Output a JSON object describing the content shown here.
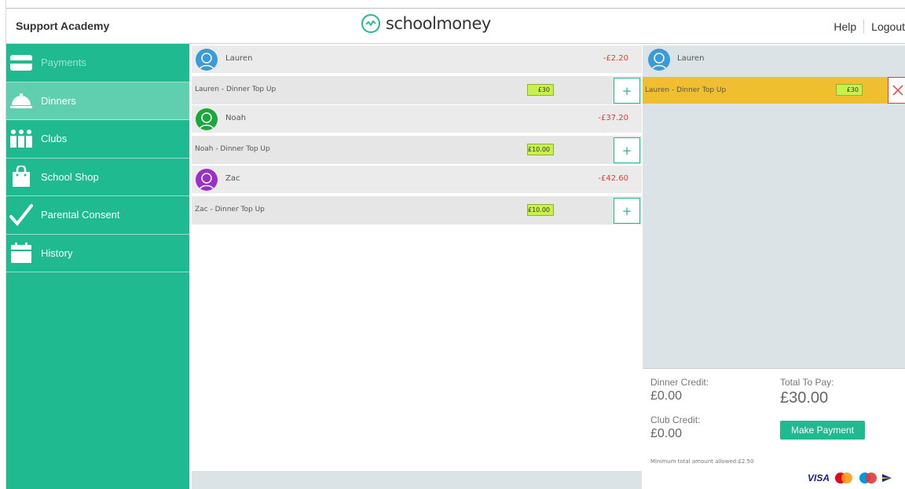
{
  "header": {
    "school_name": "Support Academy",
    "brand": "schoolmoney",
    "help": "Help",
    "logout": "Logout"
  },
  "sidebar": {
    "items": [
      {
        "label": "Payments",
        "icon": "card-icon"
      },
      {
        "label": "Dinners",
        "icon": "cloche-icon",
        "active": true
      },
      {
        "label": "Clubs",
        "icon": "people-icon"
      },
      {
        "label": "School Shop",
        "icon": "shopping-bag-icon"
      },
      {
        "label": "Parental Consent",
        "icon": "checkmark-icon"
      },
      {
        "label": "History",
        "icon": "calendar-icon"
      }
    ]
  },
  "children": [
    {
      "name": "Lauren",
      "balance": "-£2.20",
      "avatar_color": "#3b9ad9",
      "item_label": "Lauren - Dinner Top Up",
      "amount": "£30"
    },
    {
      "name": "Noah",
      "balance": "-£37.20",
      "avatar_color": "#1aa83e",
      "item_label": "Noah - Dinner Top Up",
      "amount": "£10.00"
    },
    {
      "name": "Zac",
      "balance": "-£42.60",
      "avatar_color": "#9b30c8",
      "item_label": "Zac - Dinner Top Up",
      "amount": "£10.00"
    }
  ],
  "plus_label": "+",
  "basket": {
    "child_name": "Lauren",
    "item_label": "Lauren - Dinner Top Up",
    "amount": "£30"
  },
  "totals": {
    "dinner_credit_label": "Dinner Credit:",
    "dinner_credit": "£0.00",
    "club_credit_label": "Club Credit:",
    "club_credit": "£0.00",
    "total_label": "Total To Pay:",
    "total": "£30.00",
    "make_payment": "Make Payment",
    "min_note": "Minimum total amount allowed:£2.50",
    "visa": "VISA"
  },
  "colors": {
    "accent": "#1fba8f",
    "accent_active": "#5fcfb0",
    "negative": "#e53935",
    "amount_bg": "#c8f04e",
    "basket_item": "#f0bf30"
  }
}
